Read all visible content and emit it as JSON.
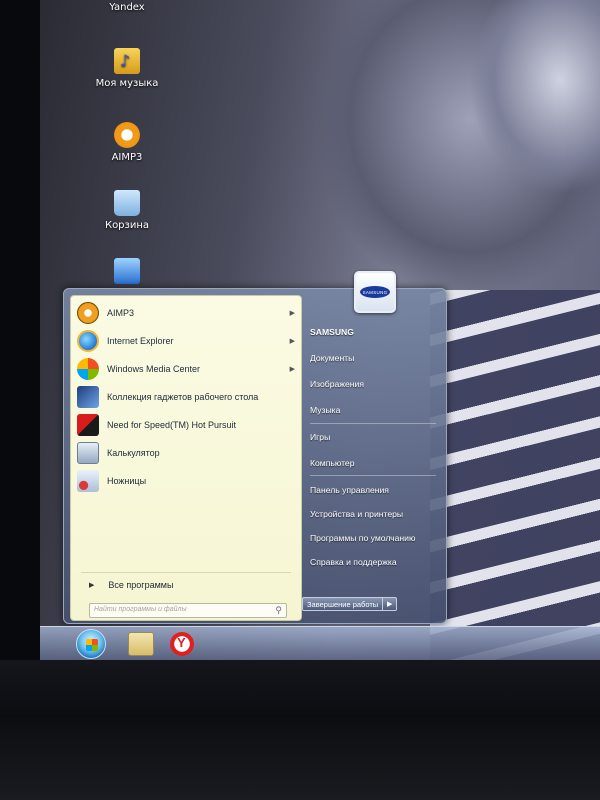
{
  "desktop": {
    "icons": [
      {
        "label": "Yandex",
        "icon": "yandex-browser-icon"
      },
      {
        "label": "Моя музыка",
        "icon": "music-folder-icon"
      },
      {
        "label": "AIMP3",
        "icon": "aimp-icon"
      },
      {
        "label": "Корзина",
        "icon": "recycle-bin-icon"
      },
      {
        "label": "",
        "icon": "computer-icon"
      }
    ]
  },
  "start_menu": {
    "programs": [
      {
        "label": "AIMP3",
        "icon": "aimp-icon",
        "submenu": true
      },
      {
        "label": "Internet Explorer",
        "icon": "internet-explorer-icon",
        "submenu": true
      },
      {
        "label": "Windows Media Center",
        "icon": "windows-media-center-icon",
        "submenu": true
      },
      {
        "label": "Коллекция гаджетов рабочего стола",
        "icon": "gadgets-icon",
        "submenu": false
      },
      {
        "label": "Need for Speed(TM) Hot Pursuit",
        "icon": "need-for-speed-icon",
        "submenu": false
      },
      {
        "label": "Калькулятор",
        "icon": "calculator-icon",
        "submenu": false
      },
      {
        "label": "Ножницы",
        "icon": "snipping-tool-icon",
        "submenu": false
      }
    ],
    "all_programs": "Все программы",
    "search_placeholder": "Найти программы и файлы",
    "user_tile_logo": "SAMSUNG",
    "right_items": [
      {
        "label": "SAMSUNG"
      },
      {
        "label": "Документы"
      },
      {
        "label": "Изображения"
      },
      {
        "label": "Музыка"
      },
      {
        "label": "Игры"
      },
      {
        "label": "Компьютер"
      },
      {
        "label": "Панель управления"
      },
      {
        "label": "Устройства и принтеры"
      },
      {
        "label": "Программы по умолчанию"
      },
      {
        "label": "Справка и поддержка"
      }
    ],
    "shutdown_label": "Завершение работы"
  },
  "taskbar": {
    "pinned": [
      "windows-explorer-icon",
      "yandex-browser-icon"
    ]
  },
  "colors": {
    "menu_left_bg": "#f6f5d2",
    "menu_frame": "#5a6585",
    "accent_orb": "#1b6cb6"
  }
}
